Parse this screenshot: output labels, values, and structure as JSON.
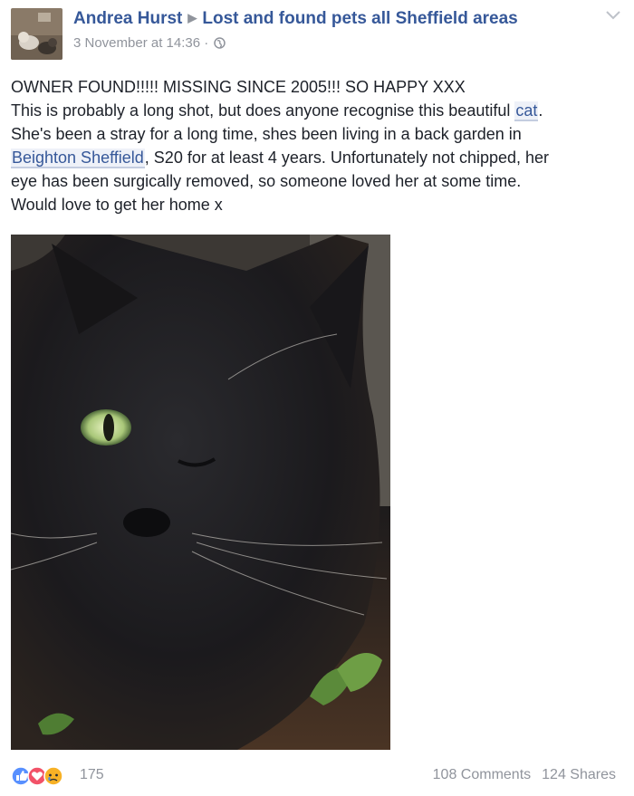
{
  "post": {
    "author": "Andrea Hurst",
    "group": "Lost and found pets all Sheffield areas",
    "timestamp": "3 November at 14:36",
    "separator": "·",
    "privacy_icon": "public-globe-icon",
    "menu_icon": "chevron-down-icon",
    "text": {
      "line1": "OWNER FOUND!!!!! MISSING SINCE 2005!!! SO HAPPY XXX",
      "line2_pre": "This is probably a long shot, but does anyone recognise this beautiful ",
      "line2_link": "cat",
      "line2_post": ".",
      "line3": "She's been a stray for a long time, shes been living in a back garden in",
      "line4_link": "Beighton Sheffield",
      "line4_post": ", S20 for at least 4 years. Unfortunately not chipped, her",
      "line5": "eye has been surgically removed, so someone loved her at some time.",
      "line6": "Would love to get her home x"
    },
    "photo_icon": "black-cat-photo"
  },
  "footer": {
    "reaction_icons": [
      "like-icon",
      "love-icon",
      "sad-icon"
    ],
    "reaction_count": "175",
    "comments": "108 Comments",
    "shares": "124 Shares"
  },
  "colors": {
    "link": "#365899",
    "meta": "#90949c",
    "text": "#1d2129",
    "like": "#5890ff",
    "love": "#f25268",
    "sad": "#f7b125"
  }
}
